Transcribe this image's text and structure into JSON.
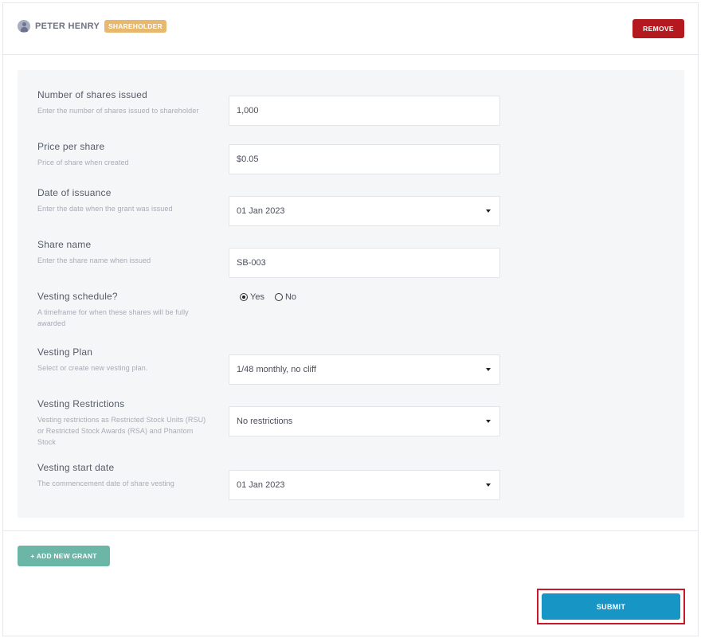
{
  "header": {
    "avatar_icon": "user-icon",
    "name": "PETER HENRY",
    "role_badge": "SHAREHOLDER",
    "remove_label": "REMOVE"
  },
  "form": {
    "shares_issued": {
      "label": "Number of shares issued",
      "help": "Enter the number of shares issued to shareholder",
      "value": "1,000"
    },
    "price_per_share": {
      "label": "Price per share",
      "help": "Price of share when created",
      "value": "$0.05"
    },
    "date_of_issuance": {
      "label": "Date of issuance",
      "help": "Enter the date when the grant was issued",
      "value": "01 Jan 2023"
    },
    "share_name": {
      "label": "Share name",
      "help": "Enter the share name when issued",
      "value": "SB-003"
    },
    "vesting_schedule": {
      "label": "Vesting schedule?",
      "help": "A timeframe for when these shares will be fully awarded",
      "options": [
        {
          "label": "Yes",
          "checked": true
        },
        {
          "label": "No",
          "checked": false
        }
      ]
    },
    "vesting_plan": {
      "label": "Vesting Plan",
      "help": "Select or create new vesting plan.",
      "value": "1/48 monthly, no cliff"
    },
    "vesting_restrictions": {
      "label": "Vesting Restrictions",
      "help": "Vesting restrictions as Restricted Stock Units (RSU) or Restricted Stock Awards (RSA) and Phantom Stock",
      "value": "No restrictions"
    },
    "vesting_start_date": {
      "label": "Vesting start date",
      "help": "The commencement date of share vesting",
      "value": "01 Jan 2023"
    }
  },
  "actions": {
    "add_grant_label": "+ ADD NEW GRANT",
    "submit_label": "SUBMIT"
  },
  "colors": {
    "remove": "#b3191f",
    "badge": "#e6b96e",
    "add_grant": "#6cb6a7",
    "submit": "#1795c5",
    "highlight": "#c8192b"
  }
}
